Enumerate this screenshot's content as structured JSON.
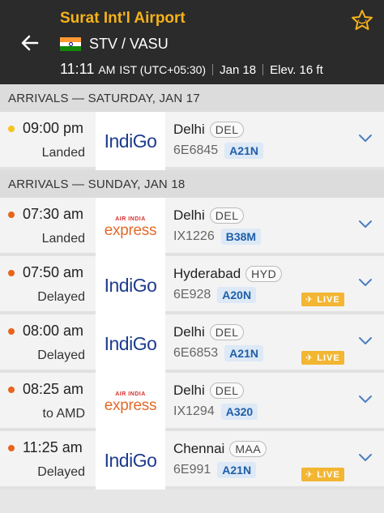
{
  "header": {
    "title": "Surat Int'l Airport",
    "codes": "STV / VASU",
    "time": "11:11",
    "ampm": "AM",
    "timezone": "IST (UTC+05:30)",
    "date": "Jan 18",
    "elevation": "Elev. 16 ft"
  },
  "colors": {
    "header_bg": "#2b2b2b",
    "accent": "#f6b21a",
    "dot_yellow": "#f5c518",
    "dot_orange": "#e8641b",
    "live_bg": "#f2b632",
    "aircraft_text": "#1f5fa8"
  },
  "sections": [
    {
      "label": "ARRIVALS — SATURDAY, JAN 17"
    },
    {
      "label": "ARRIVALS — SUNDAY, JAN 18"
    }
  ],
  "flights": [
    {
      "time": "09:00 pm",
      "status": "Landed",
      "airline": "IndiGo",
      "city": "Delhi",
      "iata": "DEL",
      "flight": "6E6845",
      "aircraft": "A21N",
      "live": "",
      "dot": "yellow"
    },
    {
      "time": "07:30 am",
      "status": "Landed",
      "airline_top": "AIR INDIA",
      "airline": "express",
      "city": "Delhi",
      "iata": "DEL",
      "flight": "IX1226",
      "aircraft": "B38M",
      "live": "",
      "dot": "orange"
    },
    {
      "time": "07:50 am",
      "status": "Delayed",
      "airline": "IndiGo",
      "city": "Hyderabad",
      "iata": "HYD",
      "flight": "6E928",
      "aircraft": "A20N",
      "live": "LIVE",
      "dot": "orange"
    },
    {
      "time": "08:00 am",
      "status": "Delayed",
      "airline": "IndiGo",
      "city": "Delhi",
      "iata": "DEL",
      "flight": "6E6853",
      "aircraft": "A21N",
      "live": "LIVE",
      "dot": "orange"
    },
    {
      "time": "08:25 am",
      "status": "to AMD",
      "airline_top": "AIR INDIA",
      "airline": "express",
      "city": "Delhi",
      "iata": "DEL",
      "flight": "IX1294",
      "aircraft": "A320",
      "live": "",
      "dot": "orange"
    },
    {
      "time": "11:25 am",
      "status": "Delayed",
      "airline": "IndiGo",
      "city": "Chennai",
      "iata": "MAA",
      "flight": "6E991",
      "aircraft": "A21N",
      "live": "LIVE",
      "dot": "orange"
    }
  ],
  "icons": {
    "back": "arrow-left-icon",
    "favorite": "star-icon",
    "expand": "chevron-down-icon",
    "live_plane": "plane-icon"
  }
}
